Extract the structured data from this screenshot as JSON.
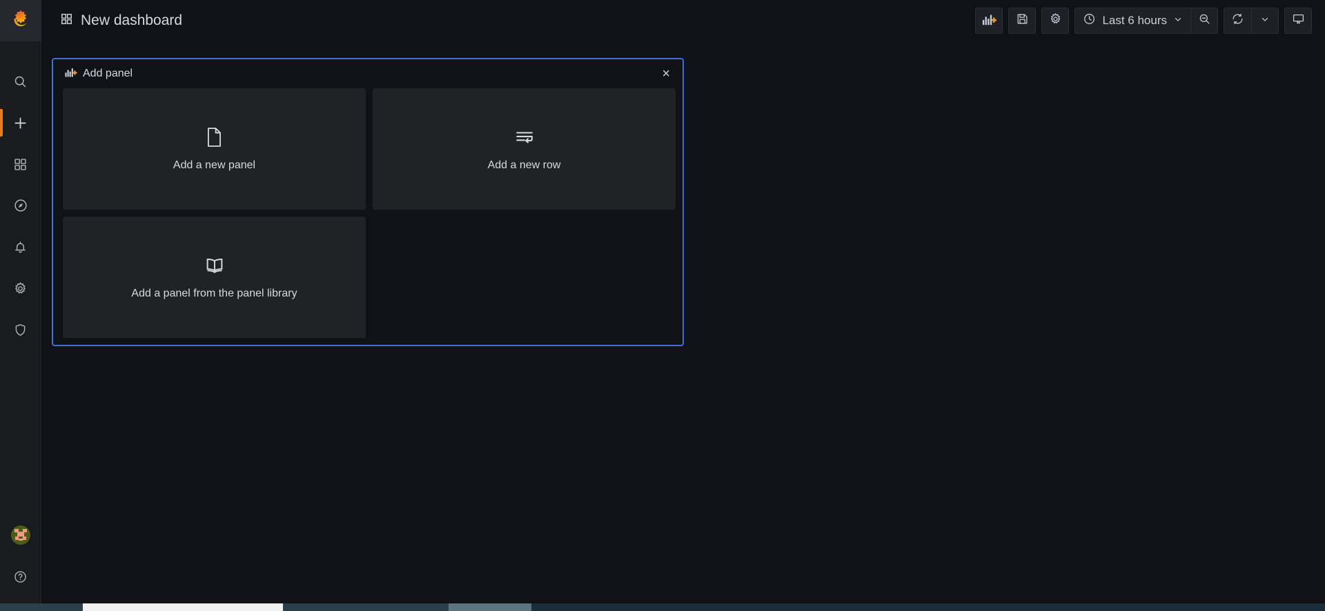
{
  "app": {
    "name": "Grafana",
    "logo_icon": "grafana-logo-icon"
  },
  "sidebar": {
    "items": [
      {
        "id": "search",
        "label": "Search dashboards",
        "icon": "search-icon",
        "active": false
      },
      {
        "id": "create",
        "label": "Create",
        "icon": "plus-icon",
        "active": true
      },
      {
        "id": "dashboards",
        "label": "Dashboards",
        "icon": "apps-grid-icon",
        "active": false
      },
      {
        "id": "explore",
        "label": "Explore",
        "icon": "compass-icon",
        "active": false
      },
      {
        "id": "alerting",
        "label": "Alerting",
        "icon": "bell-icon",
        "active": false
      },
      {
        "id": "config",
        "label": "Configuration",
        "icon": "gear-icon",
        "active": false
      },
      {
        "id": "admin",
        "label": "Server Admin",
        "icon": "shield-icon",
        "active": false
      }
    ],
    "bottom_items": [
      {
        "id": "profile",
        "label": "Profile",
        "icon": "avatar-icon"
      },
      {
        "id": "help",
        "label": "Help",
        "icon": "question-circle-icon"
      }
    ]
  },
  "topbar": {
    "breadcrumb_icon": "dashboard-grid-icon",
    "title": "New dashboard",
    "buttons": [
      {
        "id": "add-panel",
        "label": "Add panel",
        "icon": "bar-chart-plus-icon"
      },
      {
        "id": "save-dashboard",
        "label": "Save dashboard",
        "icon": "save-disk-icon"
      },
      {
        "id": "dashboard-settings",
        "label": "Dashboard settings",
        "icon": "gear-icon"
      },
      {
        "id": "zoom-out",
        "label": "Zoom out time range",
        "icon": "zoom-out-icon"
      },
      {
        "id": "refresh",
        "label": "Refresh dashboard",
        "icon": "refresh-icon"
      },
      {
        "id": "refresh-interval",
        "label": "Set auto refresh interval",
        "icon": "chevron-down-icon"
      },
      {
        "id": "tv-mode",
        "label": "Cycle view mode",
        "icon": "monitor-icon"
      }
    ],
    "time_picker": {
      "icon": "clock-icon",
      "value": "Last 6 hours",
      "caret_icon": "chevron-down-icon"
    }
  },
  "add_panel_widget": {
    "icon": "bar-chart-plus-icon",
    "title": "Add panel",
    "close_label": "×",
    "cards": [
      {
        "id": "add-new-panel",
        "label": "Add a new panel",
        "icon": "file-icon"
      },
      {
        "id": "add-new-row",
        "label": "Add a new row",
        "icon": "row-lines-icon"
      },
      {
        "id": "add-from-library",
        "label": "Add a panel from the panel library",
        "icon": "open-book-icon"
      }
    ]
  },
  "colors": {
    "accent_orange": "#eb7b18",
    "focus_blue": "#3d71d9",
    "page_bg": "#111217",
    "panel_bg": "#202226",
    "nav_bg": "#1a1b1f",
    "text_primary": "#d8d9da",
    "text_secondary": "#ccccdc"
  }
}
